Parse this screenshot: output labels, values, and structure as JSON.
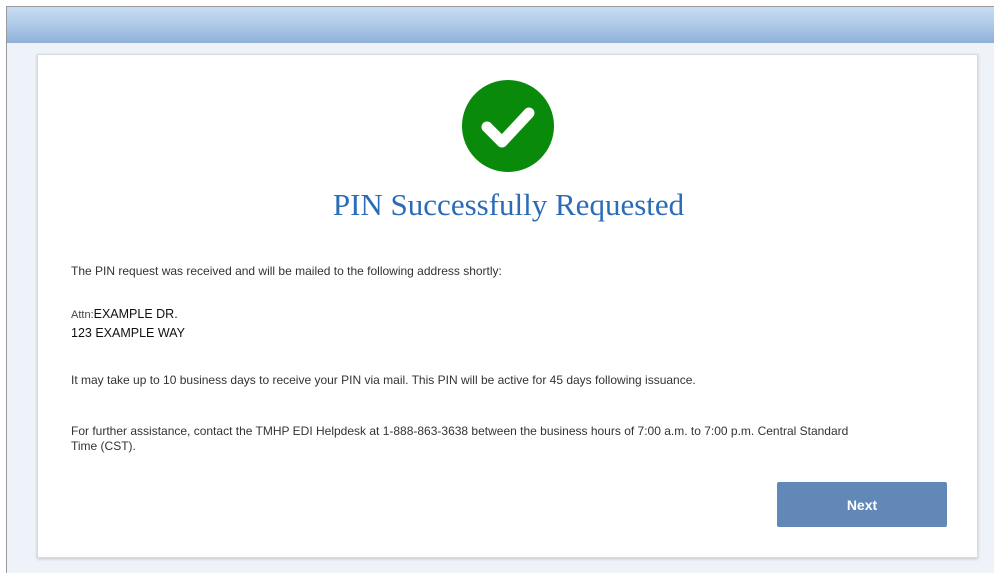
{
  "confirmation": {
    "title": "PIN Successfully Requested",
    "intro": "The PIN request was received and will be mailed to the following address shortly:",
    "address": {
      "attn_label": "Attn:",
      "attn_value": "EXAMPLE DR.",
      "street": "123 EXAMPLE WAY"
    },
    "notice": "It may take up to 10 business days to receive your PIN via mail. This PIN will be active for 45 days following issuance.",
    "help_line1": "For further assistance, contact the TMHP EDI Helpdesk at 1-888-863-3638 between the business hours of 7:00 a.m. to 7:00 p.m. Central Standard",
    "help_line2": "Time (CST).",
    "next_label": "Next",
    "success_icon": "check-circle-icon"
  },
  "colors": {
    "header_bar": "#9fbde3",
    "title": "#2b6cb8",
    "success_green": "#0a8a0a",
    "button": "#6288b7",
    "page_background": "#eef3f9"
  }
}
